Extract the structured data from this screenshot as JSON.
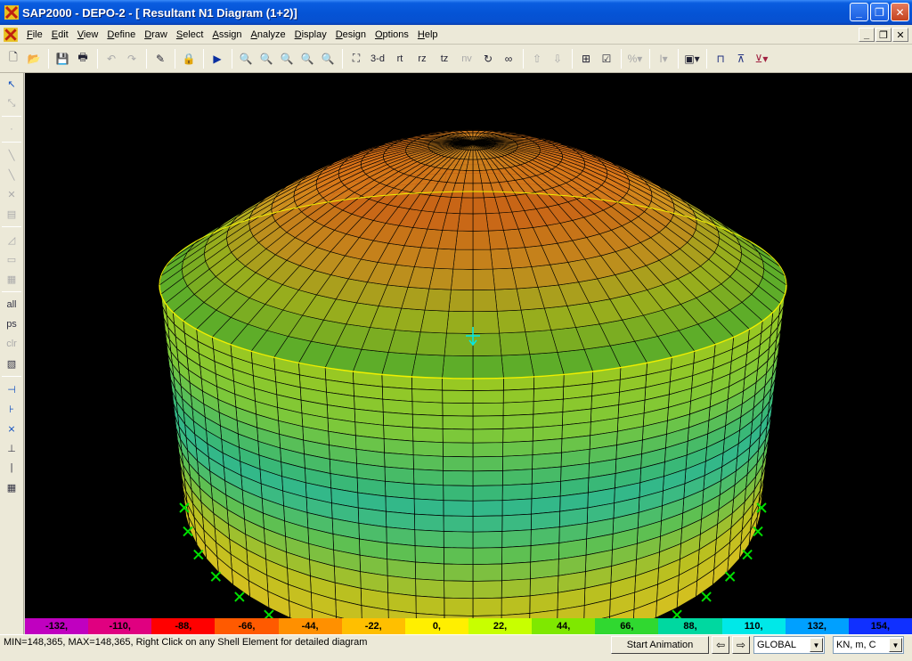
{
  "window": {
    "title": "SAP2000 - DEPO-2 - [  Resultant N1 Diagram   (1+2)]",
    "app_icon": "sap2000-logo-icon",
    "minimize": "_",
    "maximize": "❐",
    "close": "✕"
  },
  "menu": {
    "items": [
      "File",
      "Edit",
      "View",
      "Define",
      "Draw",
      "Select",
      "Assign",
      "Analyze",
      "Display",
      "Design",
      "Options",
      "Help"
    ],
    "mdi_minimize": "_",
    "mdi_restore": "❐",
    "mdi_close": "✕"
  },
  "toolbar": {
    "view_3d": "3-d",
    "view_rt": "rt",
    "view_rz": "rz",
    "view_tz": "tz",
    "view_nv": "nv"
  },
  "left_toolbar": {
    "all": "all",
    "ps": "ps",
    "clr": "clr"
  },
  "legend": {
    "values": [
      "-132,",
      "-110,",
      "-88,",
      "-66,",
      "-44,",
      "-22,",
      "0,",
      "22,",
      "44,",
      "66,",
      "88,",
      "110,",
      "132,",
      "154,"
    ],
    "colors": [
      "#c000c0",
      "#e00080",
      "#ff0000",
      "#ff5a00",
      "#ff9000",
      "#ffbf00",
      "#ffef00",
      "#c8ff00",
      "#7fe800",
      "#30d830",
      "#00d8a0",
      "#00e8e8",
      "#00a0ff",
      "#1030ff"
    ]
  },
  "status": {
    "message": "MIN=148,365, MAX=148,365, Right Click on any Shell Element for detailed diagram",
    "start_animation": "Start Animation",
    "coord_system": "GLOBAL",
    "units": "KN, m, C"
  },
  "colors": {
    "title_bar": "#0554d6",
    "viewport_bg": "#000000",
    "mesh_line": "#000000",
    "ring_line": "#f0f000",
    "support_marker": "#00e000",
    "load_arrow": "#00e8e8"
  }
}
